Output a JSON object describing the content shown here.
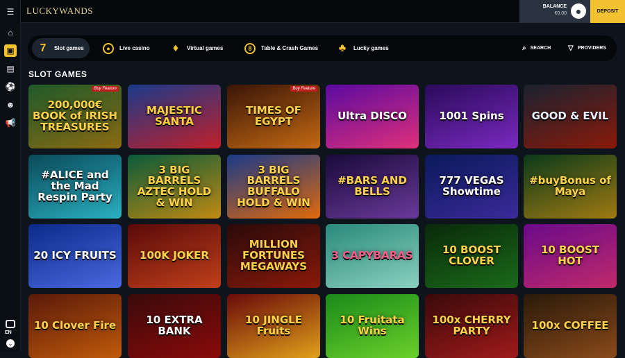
{
  "header": {
    "logo_text": "LUCKYWANDS",
    "balance_label": "BALANCE",
    "balance_value": "€0.00",
    "deposit_label": "DEPOSIT"
  },
  "language": "EN",
  "nav": {
    "tabs": [
      {
        "label": "Slot games",
        "icon": "7",
        "name": "tab-slot-games",
        "active": true
      },
      {
        "label": "Live casino",
        "icon": "●",
        "name": "tab-live-casino"
      },
      {
        "label": "Virtual games",
        "icon": "♦",
        "name": "tab-virtual-games"
      },
      {
        "label": "Table & Crash Games",
        "icon": "8",
        "name": "tab-table-crash-games"
      },
      {
        "label": "Lucky games",
        "icon": "♣",
        "name": "tab-lucky-games"
      }
    ],
    "search_label": "SEARCH",
    "providers_label": "PROVIDERS"
  },
  "section_title": "SLOT GAMES",
  "games": [
    {
      "title": "200,000€ BOOK of IRISH TREASURES",
      "badge": "Buy Feature",
      "c1": "#1f5a2a",
      "c2": "#8a6a12",
      "fg": "#ffd24a"
    },
    {
      "title": "MAJESTIC SANTA",
      "c1": "#1a3a8a",
      "c2": "#c0202a",
      "fg": "#ffd23a"
    },
    {
      "title": "TIMES OF EGYPT",
      "badge": "Buy Feature",
      "c1": "#3a1508",
      "c2": "#c46a12",
      "fg": "#ffd24a"
    },
    {
      "title": "Ultra DISCO",
      "c1": "#5a0aa0",
      "c2": "#e0307a",
      "fg": "#fff"
    },
    {
      "title": "1001 Spins",
      "c1": "#2a0a5a",
      "c2": "#7a2ac0",
      "fg": "#fff"
    },
    {
      "title": "GOOD & EVIL",
      "c1": "#1a2230",
      "c2": "#8a1a0a",
      "fg": "#e8f0ff"
    },
    {
      "title": "#ALICE and the Mad Respin Party",
      "c1": "#0a4a5a",
      "c2": "#2ab0c0",
      "fg": "#fff"
    },
    {
      "title": "3 BIG BARRELS AZTEC HOLD & WIN",
      "c1": "#0a5a3a",
      "c2": "#c08a12",
      "fg": "#ffd24a"
    },
    {
      "title": "3 BIG BARRELS BUFFALO HOLD & WIN",
      "c1": "#1a3a8a",
      "c2": "#e06a0a",
      "fg": "#ffd24a"
    },
    {
      "title": "#BARS AND BELLS",
      "c1": "#1a0a3a",
      "c2": "#6a3a9a",
      "fg": "#ffd24a"
    },
    {
      "title": "777 VEGAS Showtime",
      "c1": "#0a1a5a",
      "c2": "#3a2a9a",
      "fg": "#fff"
    },
    {
      "title": "#buyBonus of Maya",
      "c1": "#0a3a1a",
      "c2": "#a07a12",
      "fg": "#ffd24a"
    },
    {
      "title": "20 ICY FRUITS",
      "c1": "#0a2a8a",
      "c2": "#4a6ae0",
      "fg": "#fff"
    },
    {
      "title": "100K JOKER",
      "c1": "#5a0a0a",
      "c2": "#c0401a",
      "fg": "#ffd24a"
    },
    {
      "title": "MILLION FORTUNES MEGAWAYS",
      "c1": "#2a0a0a",
      "c2": "#8a1a0a",
      "fg": "#ffd24a"
    },
    {
      "title": "3 CAPYBARAS",
      "c1": "#2a8a7a",
      "c2": "#8ad0c0",
      "fg": "#ff5a8a"
    },
    {
      "title": "10 BOOST CLOVER",
      "c1": "#0a2a0a",
      "c2": "#1a6a1a",
      "fg": "#ffd24a"
    },
    {
      "title": "10 BOOST HOT",
      "c1": "#6a0a8a",
      "c2": "#c02a6a",
      "fg": "#ffd24a"
    },
    {
      "title": "10 Clover Fire",
      "c1": "#5a1a0a",
      "c2": "#c05a0a",
      "fg": "#ffd24a"
    },
    {
      "title": "10 EXTRA BANK",
      "c1": "#3a0a0a",
      "c2": "#8a0a0a",
      "fg": "#fff"
    },
    {
      "title": "10 JINGLE Fruits",
      "c1": "#6a0a0a",
      "c2": "#e0a01a",
      "fg": "#ffd24a"
    },
    {
      "title": "10 Fruitata Wins",
      "c1": "#1a8a1a",
      "c2": "#6ad02a",
      "fg": "#ffd24a"
    },
    {
      "title": "100x CHERRY PARTY",
      "c1": "#3a0a0a",
      "c2": "#a01a1a",
      "fg": "#ffd24a"
    },
    {
      "title": "100x COFFEE",
      "c1": "#2a1a0a",
      "c2": "#8a4a1a",
      "fg": "#ffd24a"
    }
  ]
}
